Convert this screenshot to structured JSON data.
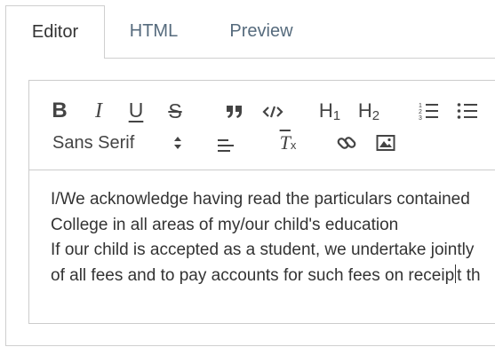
{
  "tabs": [
    {
      "label": "Editor",
      "active": true
    },
    {
      "label": "HTML",
      "active": false
    },
    {
      "label": "Preview",
      "active": false
    }
  ],
  "toolbar": {
    "buttons": [
      "bold-icon",
      "italic-icon",
      "underline-icon",
      "strikethrough-icon",
      "blockquote-icon",
      "code-icon",
      "header-1-icon",
      "header-2-icon",
      "ordered-list-icon",
      "bullet-list-icon",
      "align-icon",
      "clean-format-icon",
      "link-icon",
      "image-icon"
    ],
    "font_select": "Sans Serif",
    "header1": "H",
    "header2": "H",
    "header1_sub": "1",
    "header2_sub": "2",
    "bold": "B",
    "italic": "I",
    "underline": "U",
    "strike": "S",
    "clean": "T",
    "clean_sub": "x"
  },
  "content": {
    "lines": [
      "I/We acknowledge having read the particulars contained",
      "College in all areas of my/our child's education",
      "If our child is accepted as a student, we undertake jointly",
      "of all fees and to pay accounts for such fees on receip",
      "t th"
    ]
  },
  "colors": {
    "text": "#333333",
    "tab_inactive": "#566b7d",
    "border": "#cccccc"
  }
}
